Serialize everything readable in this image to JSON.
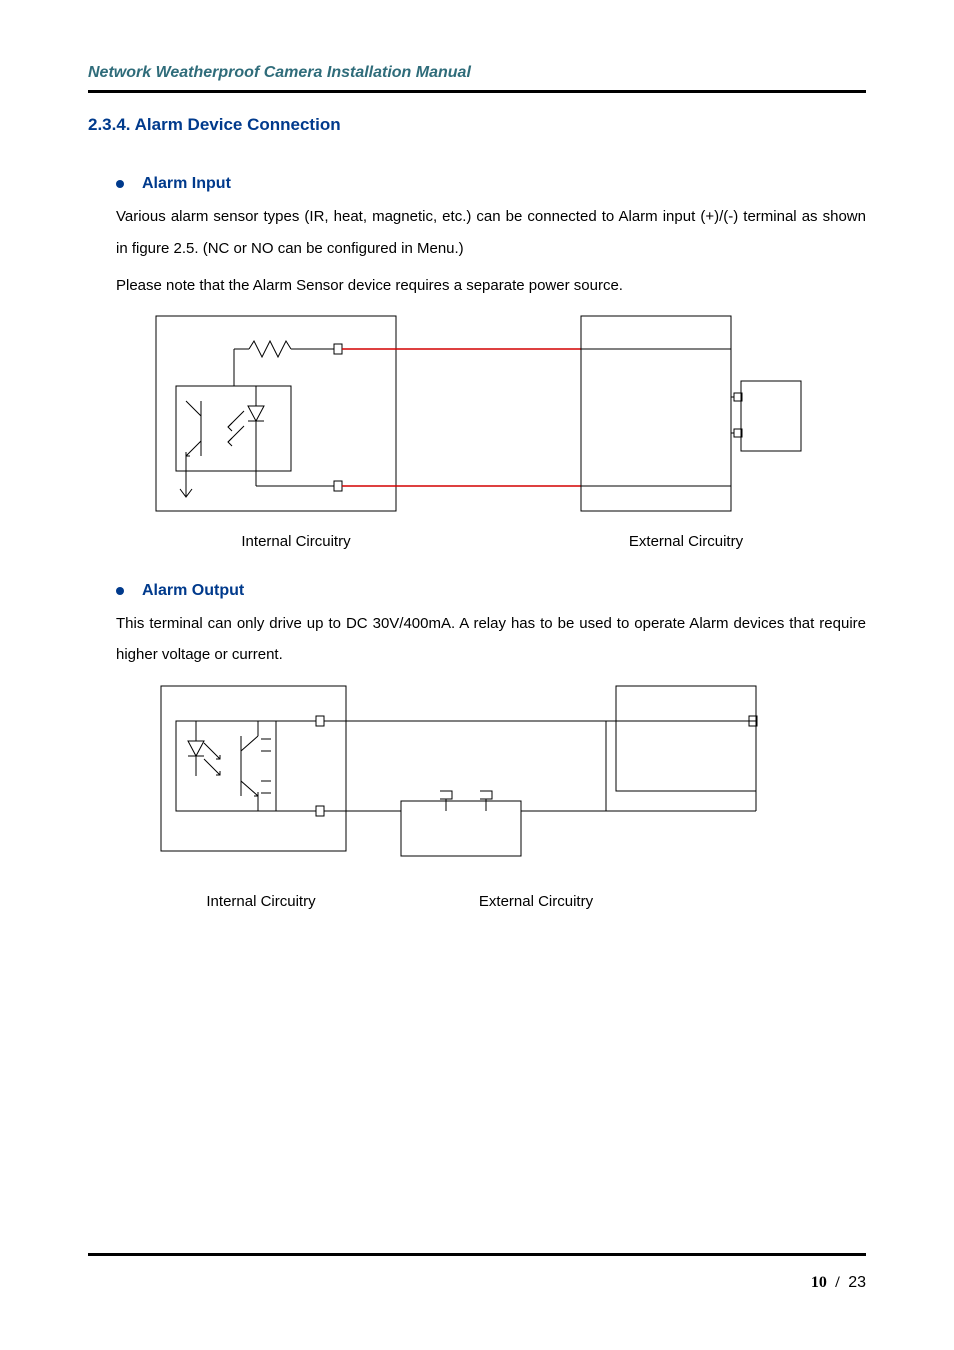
{
  "header": {
    "title": "Network Weatherproof Camera Installation Manual"
  },
  "section": {
    "number": "2.3.4.",
    "title": "Alarm Device Connection"
  },
  "alarm_input": {
    "heading": "Alarm Input",
    "p1": "Various alarm sensor types (IR, heat, magnetic, etc.) can be connected to Alarm input (+)/(-) terminal as shown in figure 2.5. (NC or NO can be configured in Menu.)",
    "p2": "Please note that the Alarm Sensor device requires a separate power source.",
    "caption_internal": "Internal Circuitry",
    "caption_external": "External Circuitry"
  },
  "alarm_output": {
    "heading": "Alarm Output",
    "p1": "This terminal can only drive up to DC 30V/400mA.   A relay has to be used to operate Alarm devices that require higher voltage or current.",
    "caption_internal": "Internal Circuitry",
    "caption_external": "External Circuitry"
  },
  "page": {
    "current": "10",
    "sep": "/",
    "total": "23"
  }
}
